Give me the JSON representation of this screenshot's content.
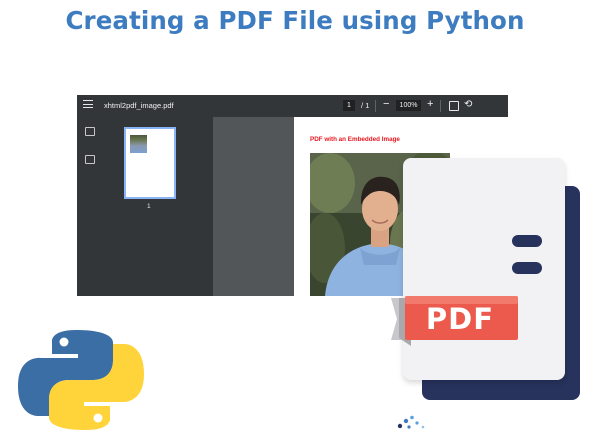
{
  "title": "Creating a PDF File using Python",
  "viewer": {
    "filename": "xhtml2pdf_image.pdf",
    "current_page": "1",
    "page_separator": "/",
    "total_pages": "1",
    "zoom_minus": "−",
    "zoom": "100%",
    "zoom_plus": "+",
    "thumbnail_page_number": "1"
  },
  "document": {
    "heading": "PDF with an Embedded Image"
  },
  "badge": {
    "label": "PDF"
  },
  "colors": {
    "title": "#3d7cc0",
    "toolbar": "#323639",
    "viewer_bg": "#525659",
    "heading_red": "#e8151d",
    "ribbon": "#ec5a4d",
    "doc_navy": "#27325d",
    "python_blue": "#3a6ea5",
    "python_yellow": "#ffd43b"
  }
}
